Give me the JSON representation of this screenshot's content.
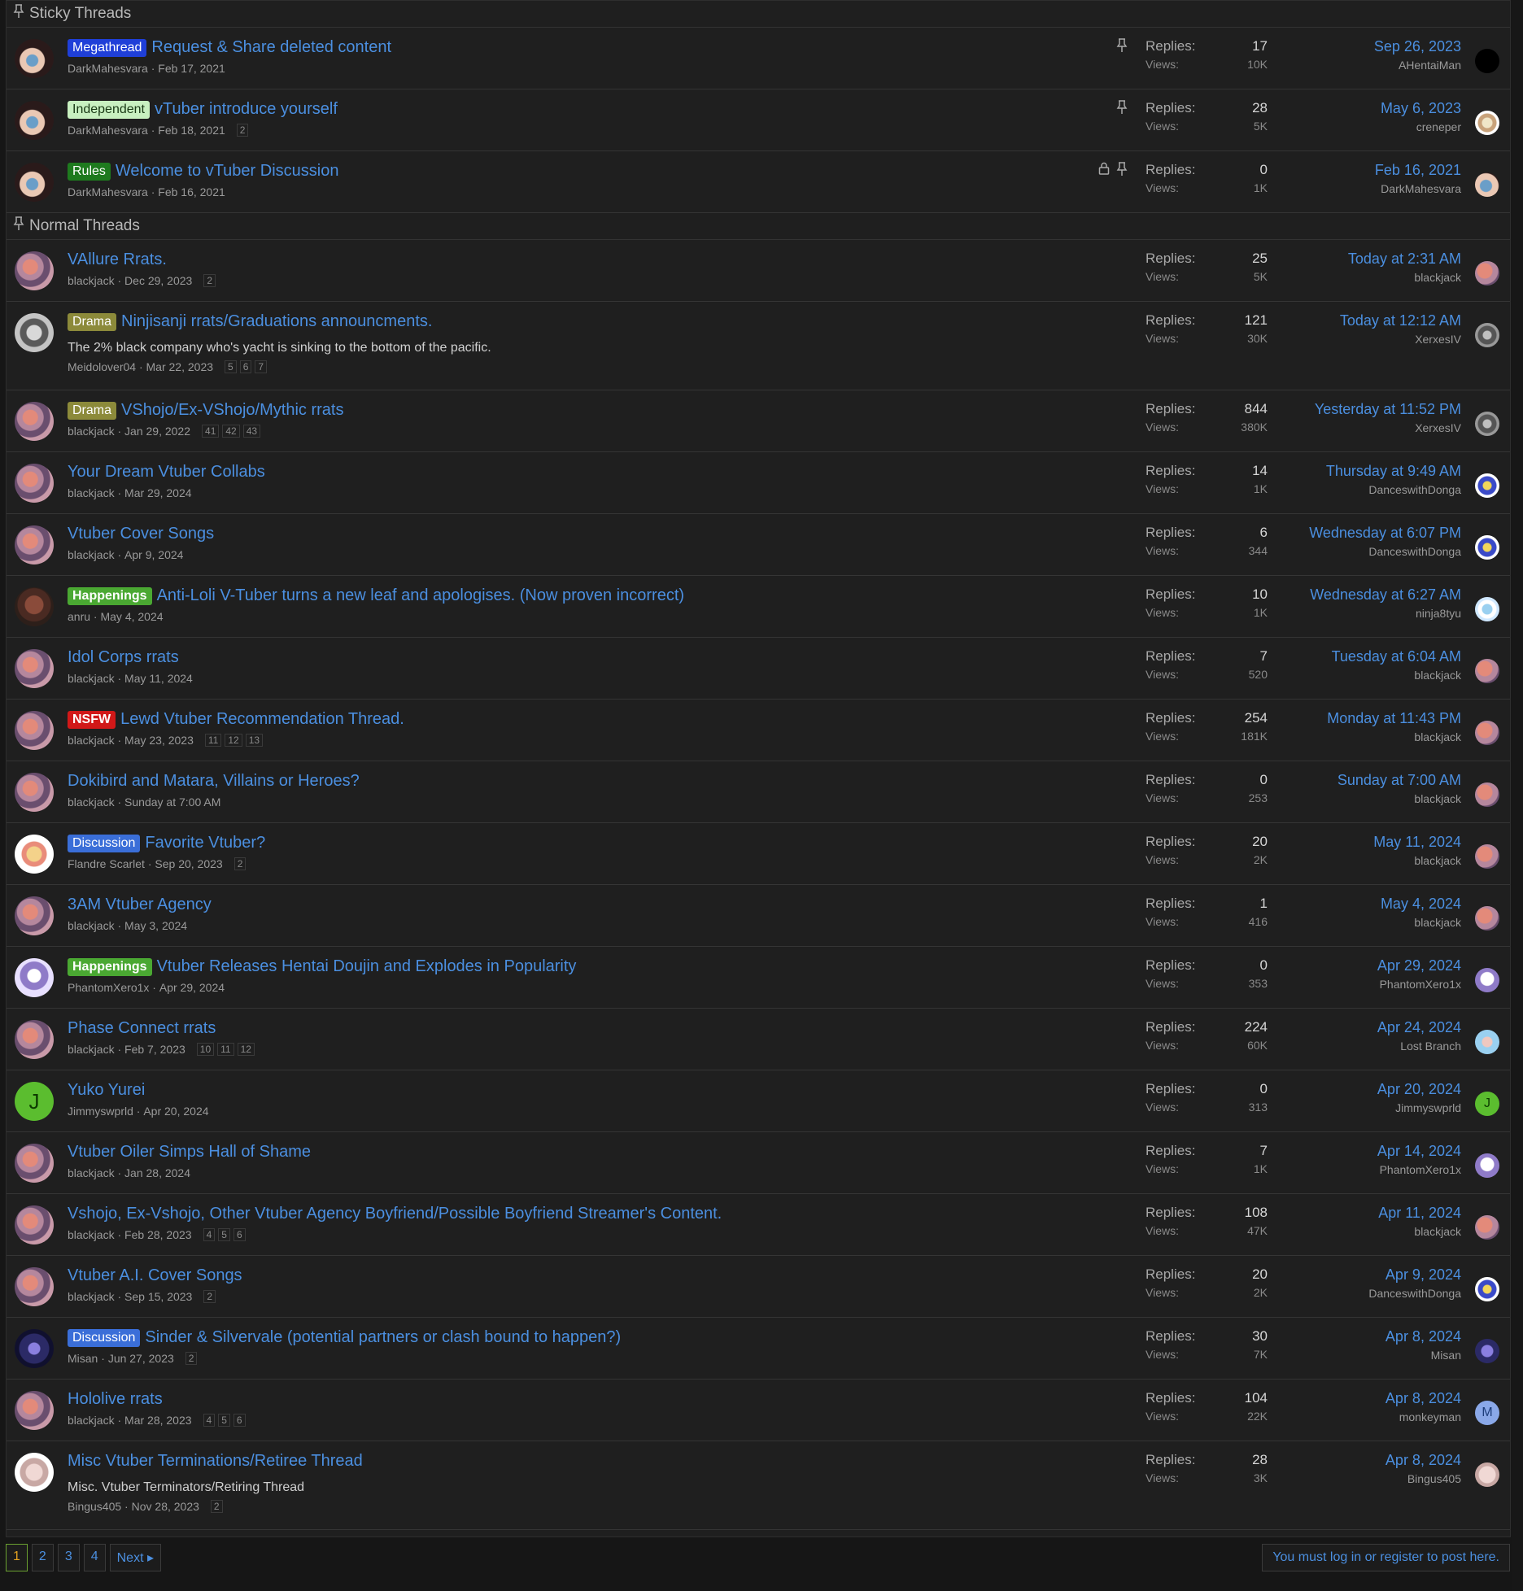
{
  "sections": {
    "sticky": "Sticky Threads",
    "normal": "Normal Threads"
  },
  "stats_labels": {
    "replies": "Replies:",
    "views": "Views:"
  },
  "sticky_threads": [
    {
      "label": "Megathread",
      "label_class": "lbl-megathread",
      "title": "Request & Share deleted content",
      "author": "DarkMahesvara",
      "date": "Feb 17, 2021",
      "pages": [],
      "replies": "17",
      "views": "10K",
      "last_date": "Sep 26, 2023",
      "last_user": "AHentaiMan",
      "avatar": "av-dark",
      "mini": "mini-black",
      "locked": false
    },
    {
      "label": "Independent",
      "label_class": "lbl-independent",
      "title": "vTuber introduce yourself",
      "author": "DarkMahesvara",
      "date": "Feb 18, 2021",
      "pages": [
        "2"
      ],
      "replies": "28",
      "views": "5K",
      "last_date": "May 6, 2023",
      "last_user": "creneper",
      "avatar": "av-dark",
      "mini": "mini-creneper",
      "locked": false
    },
    {
      "label": "Rules",
      "label_class": "lbl-rules",
      "title": "Welcome to vTuber Discussion",
      "author": "DarkMahesvara",
      "date": "Feb 16, 2021",
      "pages": [],
      "replies": "0",
      "views": "1K",
      "last_date": "Feb 16, 2021",
      "last_user": "DarkMahesvara",
      "avatar": "av-dark",
      "mini": "av-dark",
      "locked": true
    }
  ],
  "normal_threads": [
    {
      "label": "",
      "title": "VAllure Rrats.",
      "author": "blackjack",
      "date": "Dec 29, 2023",
      "pages": [
        "2"
      ],
      "replies": "25",
      "views": "5K",
      "last_date": "Today at 2:31 AM",
      "last_user": "blackjack",
      "avatar": "av-bj",
      "mini": "av-bj"
    },
    {
      "label": "Drama",
      "label_class": "lbl-drama",
      "title": "Ninjisanji rrats/Graduations announcments.",
      "snippet": "The 2% black company who's yacht is sinking to the bottom of the pacific.",
      "author": "Meidolover04",
      "date": "Mar 22, 2023",
      "pages": [
        "5",
        "6",
        "7"
      ],
      "replies": "121",
      "views": "30K",
      "last_date": "Today at 12:12 AM",
      "last_user": "XerxesIV",
      "avatar": "av-grey",
      "mini": "mini-xerxes"
    },
    {
      "label": "Drama",
      "label_class": "lbl-drama",
      "title": "VShojo/Ex-VShojo/Mythic rrats",
      "author": "blackjack",
      "date": "Jan 29, 2022",
      "pages": [
        "41",
        "42",
        "43"
      ],
      "replies": "844",
      "views": "380K",
      "last_date": "Yesterday at 11:52 PM",
      "last_user": "XerxesIV",
      "avatar": "av-bj",
      "mini": "mini-xerxes"
    },
    {
      "label": "",
      "title": "Your Dream Vtuber Collabs",
      "author": "blackjack",
      "date": "Mar 29, 2024",
      "pages": [],
      "replies": "14",
      "views": "1K",
      "last_date": "Thursday at 9:49 AM",
      "last_user": "DanceswithDonga",
      "avatar": "av-bj",
      "mini": "mini-dance"
    },
    {
      "label": "",
      "title": "Vtuber Cover Songs",
      "author": "blackjack",
      "date": "Apr 9, 2024",
      "pages": [],
      "replies": "6",
      "views": "344",
      "last_date": "Wednesday at 6:07 PM",
      "last_user": "DanceswithDonga",
      "avatar": "av-bj",
      "mini": "mini-dance"
    },
    {
      "label": "Happenings",
      "label_class": "lbl-happenings",
      "title": "Anti-Loli V-Tuber turns a new leaf and apologises. (Now proven incorrect)",
      "author": "anru",
      "date": "May 4, 2024",
      "pages": [],
      "replies": "10",
      "views": "1K",
      "last_date": "Wednesday at 6:27 AM",
      "last_user": "ninja8tyu",
      "avatar": "av-anru",
      "mini": "mini-ninja"
    },
    {
      "label": "",
      "title": "Idol Corps rrats",
      "author": "blackjack",
      "date": "May 11, 2024",
      "pages": [],
      "replies": "7",
      "views": "520",
      "last_date": "Tuesday at 6:04 AM",
      "last_user": "blackjack",
      "avatar": "av-bj",
      "mini": "av-bj"
    },
    {
      "label": "NSFW",
      "label_class": "lbl-nsfw",
      "title": "Lewd Vtuber Recommendation Thread.",
      "author": "blackjack",
      "date": "May 23, 2023",
      "pages": [
        "11",
        "12",
        "13"
      ],
      "replies": "254",
      "views": "181K",
      "last_date": "Monday at 11:43 PM",
      "last_user": "blackjack",
      "avatar": "av-bj",
      "mini": "av-bj"
    },
    {
      "label": "",
      "title": "Dokibird and Matara, Villains or Heroes?",
      "author": "blackjack",
      "date": "Sunday at 7:00 AM",
      "pages": [],
      "replies": "0",
      "views": "253",
      "last_date": "Sunday at 7:00 AM",
      "last_user": "blackjack",
      "avatar": "av-bj",
      "mini": "av-bj"
    },
    {
      "label": "Discussion",
      "label_class": "lbl-discussion",
      "title": "Favorite Vtuber?",
      "author": "Flandre Scarlet",
      "date": "Sep 20, 2023",
      "pages": [
        "2"
      ],
      "replies": "20",
      "views": "2K",
      "last_date": "May 11, 2024",
      "last_user": "blackjack",
      "avatar": "av-flan",
      "mini": "av-bj"
    },
    {
      "label": "",
      "title": "3AM Vtuber Agency",
      "author": "blackjack",
      "date": "May 3, 2024",
      "pages": [],
      "replies": "1",
      "views": "416",
      "last_date": "May 4, 2024",
      "last_user": "blackjack",
      "avatar": "av-bj",
      "mini": "av-bj"
    },
    {
      "label": "Happenings",
      "label_class": "lbl-happenings",
      "title": "Vtuber Releases Hentai Doujin and Explodes in Popularity",
      "author": "PhantomXero1x",
      "date": "Apr 29, 2024",
      "pages": [],
      "replies": "0",
      "views": "353",
      "last_date": "Apr 29, 2024",
      "last_user": "PhantomXero1x",
      "avatar": "av-phantom",
      "mini": "av-phantom"
    },
    {
      "label": "",
      "title": "Phase Connect rrats",
      "author": "blackjack",
      "date": "Feb 7, 2023",
      "pages": [
        "10",
        "11",
        "12"
      ],
      "replies": "224",
      "views": "60K",
      "last_date": "Apr 24, 2024",
      "last_user": "Lost Branch",
      "avatar": "av-bj",
      "mini": "mini-lost"
    },
    {
      "label": "",
      "title": "Yuko Yurei",
      "author": "Jimmyswprld",
      "date": "Apr 20, 2024",
      "pages": [],
      "replies": "0",
      "views": "313",
      "last_date": "Apr 20, 2024",
      "last_user": "Jimmyswprld",
      "avatar": "av-letter",
      "avatar_letter": "J",
      "mini": "mini-letter-j",
      "mini_letter": "J"
    },
    {
      "label": "",
      "title": "Vtuber Oiler Simps Hall of Shame",
      "author": "blackjack",
      "date": "Jan 28, 2024",
      "pages": [],
      "replies": "7",
      "views": "1K",
      "last_date": "Apr 14, 2024",
      "last_user": "PhantomXero1x",
      "avatar": "av-bj",
      "mini": "av-phantom"
    },
    {
      "label": "",
      "title": "Vshojo, Ex-Vshojo, Other Vtuber Agency Boyfriend/Possible Boyfriend Streamer's Content.",
      "author": "blackjack",
      "date": "Feb 28, 2023",
      "pages": [
        "4",
        "5",
        "6"
      ],
      "replies": "108",
      "views": "47K",
      "last_date": "Apr 11, 2024",
      "last_user": "blackjack",
      "avatar": "av-bj",
      "mini": "av-bj"
    },
    {
      "label": "",
      "title": "Vtuber A.I. Cover Songs",
      "author": "blackjack",
      "date": "Sep 15, 2023",
      "pages": [
        "2"
      ],
      "replies": "20",
      "views": "2K",
      "last_date": "Apr 9, 2024",
      "last_user": "DanceswithDonga",
      "avatar": "av-bj",
      "mini": "mini-dance"
    },
    {
      "label": "Discussion",
      "label_class": "lbl-discussion",
      "title": "Sinder & Silvervale (potential partners or clash bound to happen?)",
      "author": "Misan",
      "date": "Jun 27, 2023",
      "pages": [
        "2"
      ],
      "replies": "30",
      "views": "7K",
      "last_date": "Apr 8, 2024",
      "last_user": "Misan",
      "avatar": "av-misan",
      "mini": "av-misan"
    },
    {
      "label": "",
      "title": "Hololive rrats",
      "author": "blackjack",
      "date": "Mar 28, 2023",
      "pages": [
        "4",
        "5",
        "6"
      ],
      "replies": "104",
      "views": "22K",
      "last_date": "Apr 8, 2024",
      "last_user": "monkeyman",
      "avatar": "av-bj",
      "mini": "mini-letter-m",
      "mini_letter": "M"
    },
    {
      "label": "",
      "title": "Misc Vtuber Terminations/Retiree Thread",
      "snippet": "Misc. Vtuber Terminators/Retiring Thread",
      "author": "Bingus405",
      "date": "Nov 28, 2023",
      "pages": [
        "2"
      ],
      "replies": "28",
      "views": "3K",
      "last_date": "Apr 8, 2024",
      "last_user": "Bingus405",
      "avatar": "av-bingus",
      "mini": "av-bingus"
    }
  ],
  "pagination": {
    "pages": [
      "1",
      "2",
      "3",
      "4"
    ],
    "next": "Next ▸",
    "active": "1"
  },
  "post_notice": "You must log in or register to post here.",
  "colors": {
    "accent": "#4b8fe0",
    "background": "#1f1f1f"
  }
}
